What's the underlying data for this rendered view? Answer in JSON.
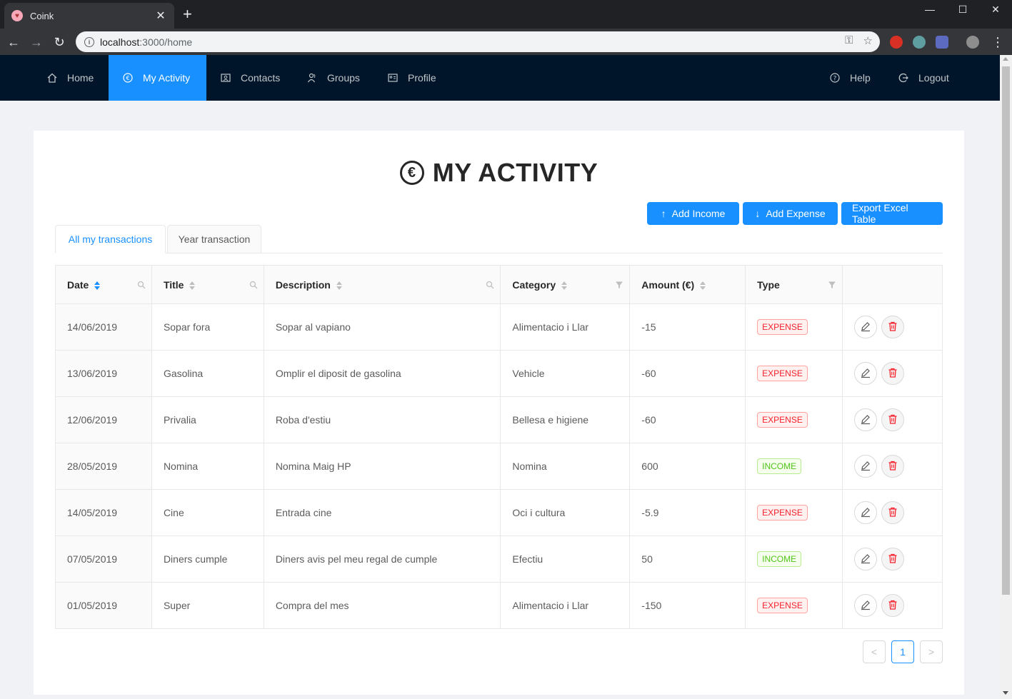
{
  "browser": {
    "tab_title": "Coink",
    "url_host": "localhost",
    "url_rest": ":3000/home"
  },
  "nav": {
    "items": [
      {
        "label": "Home",
        "icon": "home-icon"
      },
      {
        "label": "My Activity",
        "icon": "euro-icon",
        "active": true
      },
      {
        "label": "Contacts",
        "icon": "contacts-icon"
      },
      {
        "label": "Groups",
        "icon": "groups-icon"
      },
      {
        "label": "Profile",
        "icon": "profile-icon"
      }
    ],
    "right": [
      {
        "label": "Help",
        "icon": "help-icon"
      },
      {
        "label": "Logout",
        "icon": "logout-icon"
      }
    ]
  },
  "page": {
    "title": "MY ACTIVITY",
    "buttons": {
      "add_income": "Add Income",
      "add_expense": "Add Expense",
      "export": "Export Excel Table"
    },
    "tabs": [
      "All my transactions",
      "Year transaction"
    ]
  },
  "table": {
    "columns": [
      "Date",
      "Title",
      "Description",
      "Category",
      "Amount (€)",
      "Type"
    ],
    "rows": [
      {
        "date": "14/06/2019",
        "title": "Sopar fora",
        "description": "Sopar al vapiano",
        "category": "Alimentacio i Llar",
        "amount": "-15",
        "type": "EXPENSE"
      },
      {
        "date": "13/06/2019",
        "title": "Gasolina",
        "description": "Omplir el diposit de gasolina",
        "category": "Vehicle",
        "amount": "-60",
        "type": "EXPENSE"
      },
      {
        "date": "12/06/2019",
        "title": "Privalia",
        "description": "Roba d'estiu",
        "category": "Bellesa e higiene",
        "amount": "-60",
        "type": "EXPENSE"
      },
      {
        "date": "28/05/2019",
        "title": "Nomina",
        "description": "Nomina Maig HP",
        "category": "Nomina",
        "amount": "600",
        "type": "INCOME"
      },
      {
        "date": "14/05/2019",
        "title": "Cine",
        "description": "Entrada cine",
        "category": "Oci i cultura",
        "amount": "-5.9",
        "type": "EXPENSE"
      },
      {
        "date": "07/05/2019",
        "title": "Diners cumple",
        "description": "Diners avis pel meu regal de cumple",
        "category": "Efectiu",
        "amount": "50",
        "type": "INCOME"
      },
      {
        "date": "01/05/2019",
        "title": "Super",
        "description": "Compra del mes",
        "category": "Alimentacio i Llar",
        "amount": "-150",
        "type": "EXPENSE"
      }
    ]
  },
  "pagination": {
    "current": "1",
    "prev": "<",
    "next": ">"
  },
  "colors": {
    "header_bg": "#001529",
    "accent": "#1890ff",
    "expense": "#f5222d",
    "income": "#52c41a"
  }
}
